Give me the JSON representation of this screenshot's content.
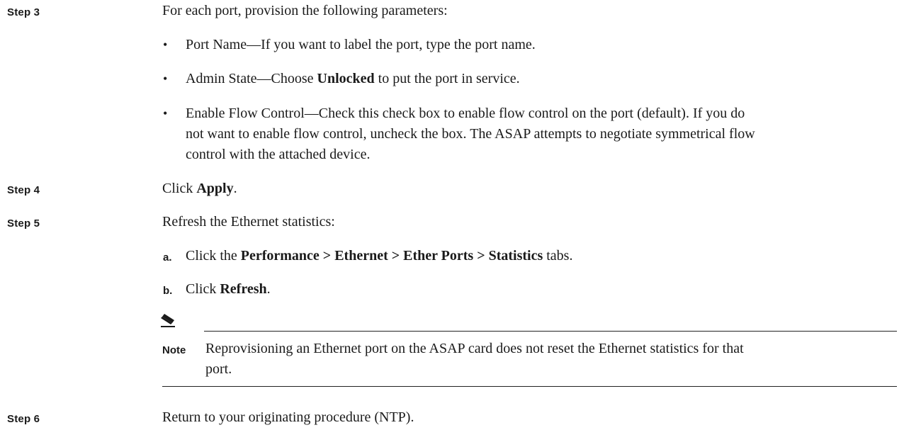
{
  "steps": {
    "s3": {
      "label": "Step 3",
      "text": "For each port, provision the following parameters:",
      "bullets": [
        {
          "text": "Port Name—If you want to label the port, type the port name."
        },
        {
          "pre": "Admin State—Choose ",
          "bold": "Unlocked",
          "post": " to put the port in service."
        },
        {
          "lines": [
            "Enable Flow Control—Check this check box to enable flow control on the port (default). If you do",
            "not want to enable flow control, uncheck the box. The ASAP attempts to negotiate symmetrical flow",
            "control with the attached device."
          ]
        }
      ]
    },
    "s4": {
      "label": "Step 4",
      "pre": "Click ",
      "bold": "Apply",
      "post": "."
    },
    "s5": {
      "label": "Step 5",
      "text": "Refresh the Ethernet statistics:",
      "subs": [
        {
          "label": "a.",
          "pre": "Click the ",
          "bold": "Performance > Ethernet > Ether Ports > Statistics",
          "post": " tabs."
        },
        {
          "label": "b.",
          "pre": "Click ",
          "bold": "Refresh",
          "post": "."
        }
      ]
    },
    "note": {
      "label": "Note",
      "line1": "Reprovisioning an Ethernet port on the ASAP card does not reset the Ethernet statistics for that",
      "line2": "port.",
      "icon": "pencil-note-icon"
    },
    "s6": {
      "label": "Step 6",
      "text": "Return to your originating procedure (NTP)."
    }
  }
}
